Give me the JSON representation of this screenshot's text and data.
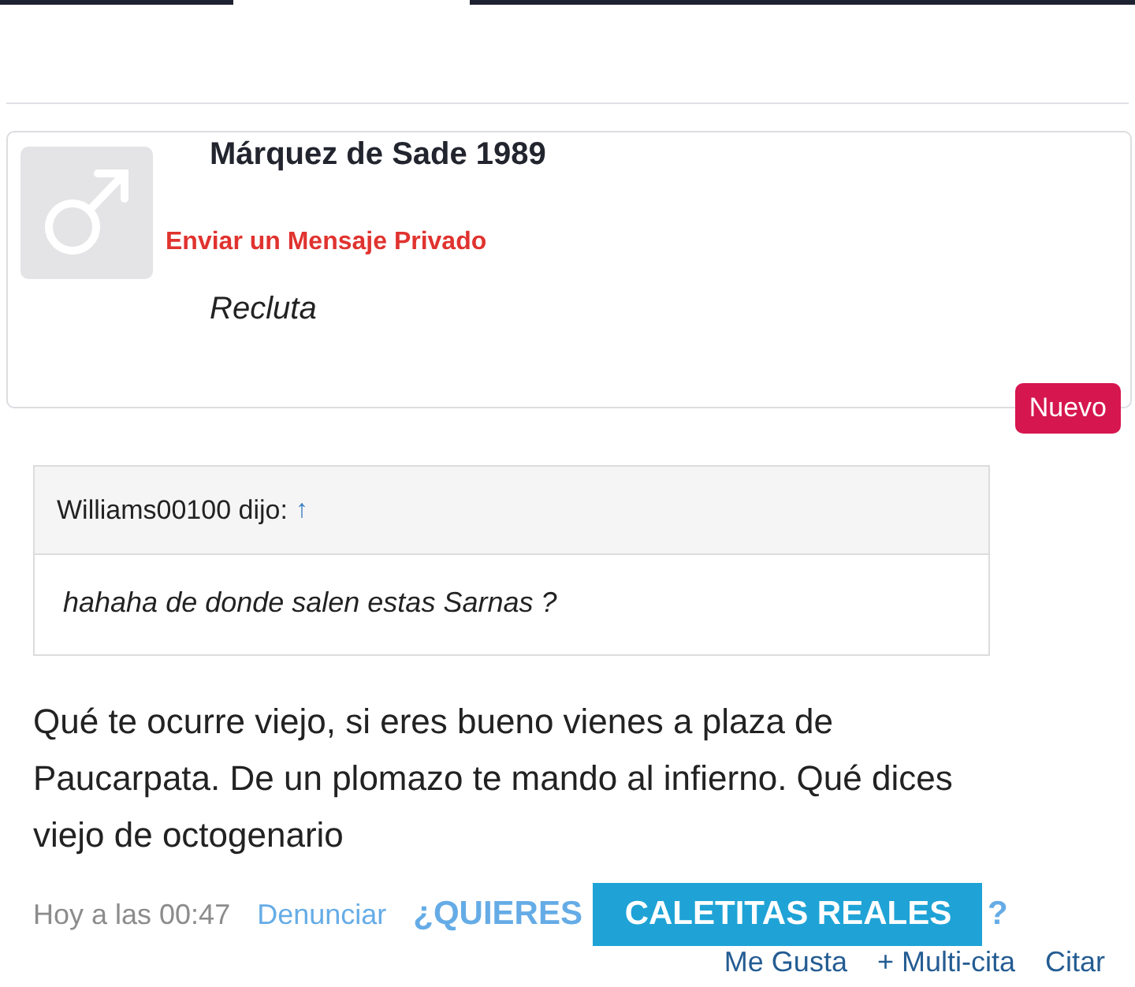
{
  "post": {
    "author": "Márquez de Sade 1989",
    "private_message_link": "Enviar un Mensaje Privado",
    "rank": "Recluta",
    "badge": "Nuevo"
  },
  "quote": {
    "header": "Williams00100 dijo:",
    "jump": "↑",
    "text": "hahaha de donde salen estas Sarnas ?"
  },
  "message": "Qué te ocurre viejo, si eres bueno vienes a plaza de Paucarpata. De un plomazo te mando al infierno. Qué dices viejo de octogenario",
  "footer": {
    "time": "Hoy a las 00:47",
    "report": "Denunciar",
    "ad_prefix": "¿QUIERES",
    "ad_button": "CALETITAS REALES",
    "ad_suffix": "?"
  },
  "actions": [
    "Me Gusta",
    "+ Multi-cita",
    "Citar"
  ]
}
